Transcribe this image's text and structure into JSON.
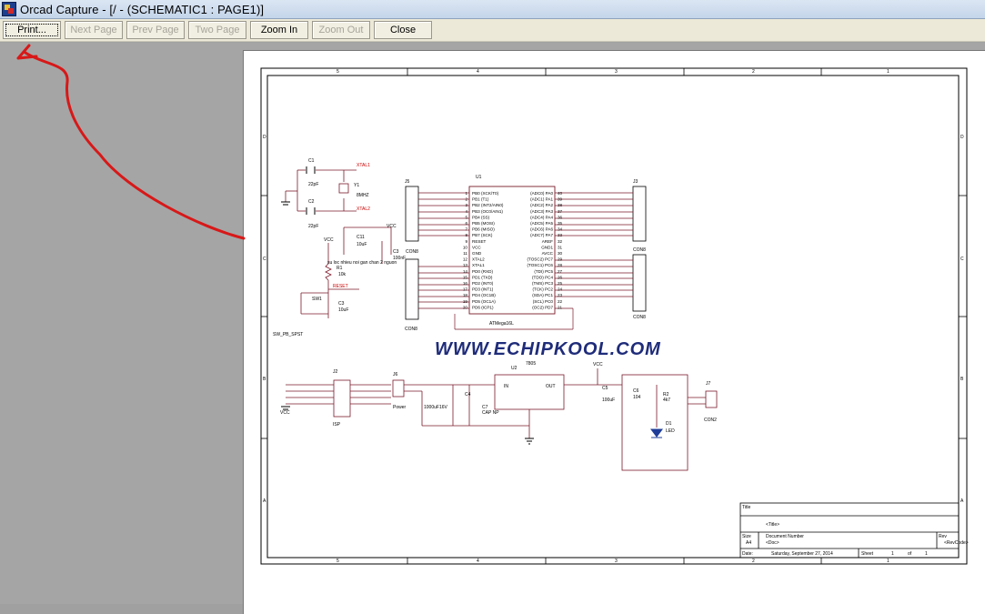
{
  "window": {
    "title": "Orcad Capture - [/ - (SCHEMATIC1 : PAGE1)]"
  },
  "toolbar": {
    "print": "Print...",
    "next_page": "Next Page",
    "prev_page": "Prev Page",
    "two_page": "Two Page",
    "zoom_in": "Zoom In",
    "zoom_out": "Zoom Out",
    "close": "Close"
  },
  "schematic": {
    "watermark": "WWW.ECHIPKOOL.COM",
    "border_cols": [
      "5",
      "4",
      "3",
      "2",
      "1"
    ],
    "border_rows": [
      "D",
      "C",
      "B",
      "A"
    ],
    "components": {
      "c1": "C1",
      "c1_val": "22pF",
      "c2": "C2",
      "c2_val": "22pF",
      "y1": "Y1",
      "y1_val": "8MHZ",
      "xtal1": "XTAL1",
      "xtal2": "XTAL2",
      "j5": "J5",
      "u1": "U1",
      "u1_part": "ATMega16L",
      "j3": "J3",
      "con8_a": "CON8",
      "con8_b": "CON8",
      "con8_c": "CON8",
      "con8_d": "CON8",
      "c11": "C11",
      "c11_val": "10uF",
      "c3_top": "C3",
      "c3_top_val": "100nF",
      "vcc": "VCC",
      "r1": "R1",
      "r1_val": "10k",
      "reset": "RESET",
      "sw1": "SW1",
      "sw1_part": "SW_PB_SPST",
      "c3": "C3",
      "c3_val": "10uF",
      "note": "su loc nhieu noi gan chan 2 nguon",
      "j2": "J2",
      "isp": "ISP",
      "j6": "J6",
      "power": "Power",
      "cap1000": "1000uF16V",
      "c4": "C4",
      "c7": "C7",
      "cap_np": "CAP NP",
      "u2": "U2",
      "u2_part": "7805",
      "in": "IN",
      "out": "OUT",
      "gnd": "GND",
      "c5": "C5",
      "c5_val": "100uF",
      "c6": "C6",
      "c6_val": "104",
      "r2": "R2",
      "r2_val": "4k7",
      "d1": "D1",
      "led": "LED",
      "j7": "J7",
      "con2": "CON2"
    },
    "u1_left_pins": [
      "PB0 (XCK/T0)",
      "PB1 (T1)",
      "PB2 (INT2/AIN0)",
      "PB3 (OC0/AIN1)",
      "PB4 (SS)",
      "PB5 (MOSI)",
      "PB6 (MISO)",
      "PB7 (SCK)",
      "RESET",
      "VCC",
      "GND",
      "XTAL2",
      "XTAL1",
      "PD0 (RXD)",
      "PD1 (TXD)",
      "PD2 (INT0)",
      "PD3 (INT1)",
      "PD4 (OC1B)",
      "PD5 (OC1A)",
      "PD6 (ICP1)"
    ],
    "u1_right_pins": [
      "(ADC0) PA0",
      "(ADC1) PA1",
      "(ADC2) PA2",
      "(ADC3) PA3",
      "(ADC4) PA4",
      "(ADC5) PA5",
      "(ADC6) PA6",
      "(ADC7) PA7",
      "AREF",
      "GND1",
      "AVCC",
      "(TOSC2) PC7",
      "(TOSC1) PC6",
      "(TDI) PC5",
      "(TDO) PC4",
      "(TMS) PC3",
      "(TCK) PC2",
      "(SDA) PC1",
      "(SCL) PC0",
      "(OC2) PD7"
    ],
    "u1_left_nums": [
      "1",
      "2",
      "3",
      "4",
      "5",
      "6",
      "7",
      "8",
      "9",
      "10",
      "11",
      "12",
      "13",
      "14",
      "15",
      "16",
      "17",
      "18",
      "19",
      "20"
    ],
    "u1_right_nums": [
      "40",
      "39",
      "38",
      "37",
      "36",
      "35",
      "34",
      "33",
      "32",
      "31",
      "30",
      "29",
      "28",
      "27",
      "26",
      "25",
      "24",
      "23",
      "22",
      "21"
    ],
    "title_block": {
      "title_label": "Title",
      "title_value": "<Title>",
      "size_label": "Size",
      "size_value": "A4",
      "doc_label": "Document Number",
      "doc_value": "<Doc>",
      "rev_label": "Rev",
      "rev_value": "<RevCode>",
      "date_label": "Date:",
      "date_value": "Saturday, September 27, 2014",
      "sheet_label": "Sheet",
      "sheet_value": "1",
      "of_label": "of",
      "of_value": "1"
    }
  },
  "colors": {
    "wire": "#7a1a2a",
    "netlabel": "#cc0000",
    "watermark": "#1f2c7a",
    "annotation_arrow": "#d81818"
  }
}
